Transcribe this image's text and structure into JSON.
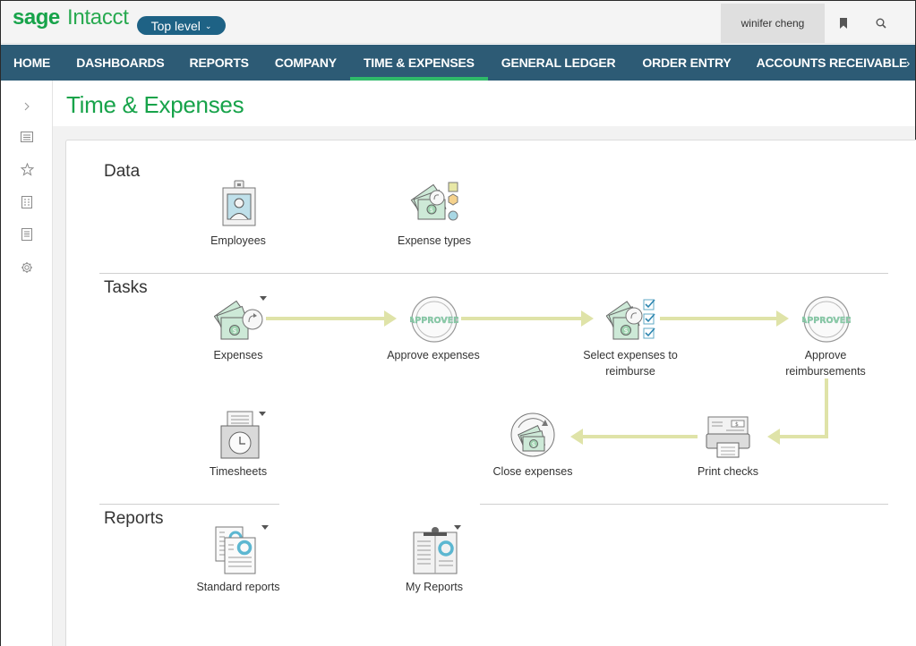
{
  "topbar": {
    "brand_sage": "sage",
    "brand_intacct": "Intacct",
    "level_label": "Top level",
    "user_name": "winifer cheng"
  },
  "nav": {
    "items": [
      {
        "label": "HOME"
      },
      {
        "label": "DASHBOARDS"
      },
      {
        "label": "REPORTS"
      },
      {
        "label": "COMPANY"
      },
      {
        "label": "TIME & EXPENSES",
        "active": true
      },
      {
        "label": "GENERAL LEDGER"
      },
      {
        "label": "ORDER ENTRY"
      },
      {
        "label": "ACCOUNTS RECEIVABLE"
      }
    ],
    "more": "›"
  },
  "rail": {
    "icons": [
      "chevron-right-icon",
      "list-icon",
      "star-icon",
      "grid-doc-icon",
      "document-icon",
      "gear-icon"
    ]
  },
  "page": {
    "title": "Time & Expenses"
  },
  "sections": {
    "data": {
      "title": "Data",
      "items": [
        "Employees",
        "Expense types"
      ]
    },
    "tasks": {
      "title": "Tasks",
      "items": {
        "expenses": "Expenses",
        "approve_expenses": "Approve expenses",
        "select_line1": "Select expenses to",
        "select_line2": "reimburse",
        "approve_reimb_line1": "Approve",
        "approve_reimb_line2": "reimbursements",
        "timesheets": "Timesheets",
        "close_expenses": "Close expenses",
        "print_checks": "Print checks"
      },
      "stamp": "APPROVED"
    },
    "reports": {
      "title": "Reports",
      "items": [
        "Standard reports",
        "My Reports"
      ]
    }
  },
  "colors": {
    "brand_green": "#17a34a",
    "nav_bg": "#2d5b75",
    "nav_active": "#2fba6a",
    "level_btn": "#1e6285",
    "arrow": "#dfe3a8",
    "money_green": "#8fcfa6"
  }
}
